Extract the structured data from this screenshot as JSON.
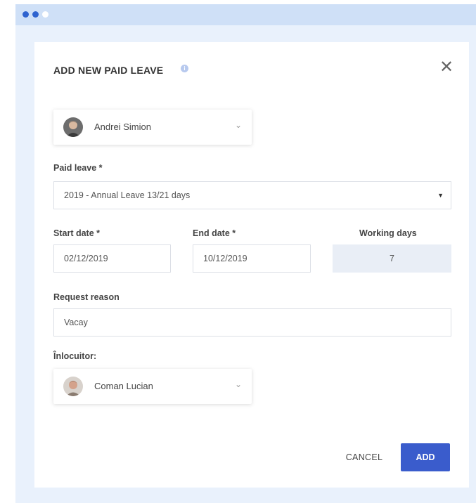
{
  "window": {
    "dots": [
      "blue",
      "blue",
      "white"
    ]
  },
  "modal": {
    "title": "ADD NEW PAID LEAVE",
    "info_icon": "info-icon",
    "close_icon": "close-icon",
    "close_symbol": "✕"
  },
  "employee": {
    "name": "Andrei Simion",
    "chevron": "⌄"
  },
  "paid_leave": {
    "label": "Paid leave *",
    "value": "2019 - Annual Leave 13/21 days",
    "arrow": "▼"
  },
  "start_date": {
    "label": "Start date *",
    "value": "02/12/2019"
  },
  "end_date": {
    "label": "End date *",
    "value": "10/12/2019"
  },
  "working_days": {
    "label": "Working days",
    "value": "7"
  },
  "request_reason": {
    "label": "Request reason",
    "value": "Vacay"
  },
  "replacement": {
    "label": "Înlocuitor:",
    "name": "Coman Lucian",
    "chevron": "⌄"
  },
  "actions": {
    "cancel_label": "CANCEL",
    "add_label": "ADD"
  },
  "colors": {
    "accent": "#3a5ccc",
    "titlebar": "#cfe0f7",
    "background": "#e9f1fc"
  }
}
